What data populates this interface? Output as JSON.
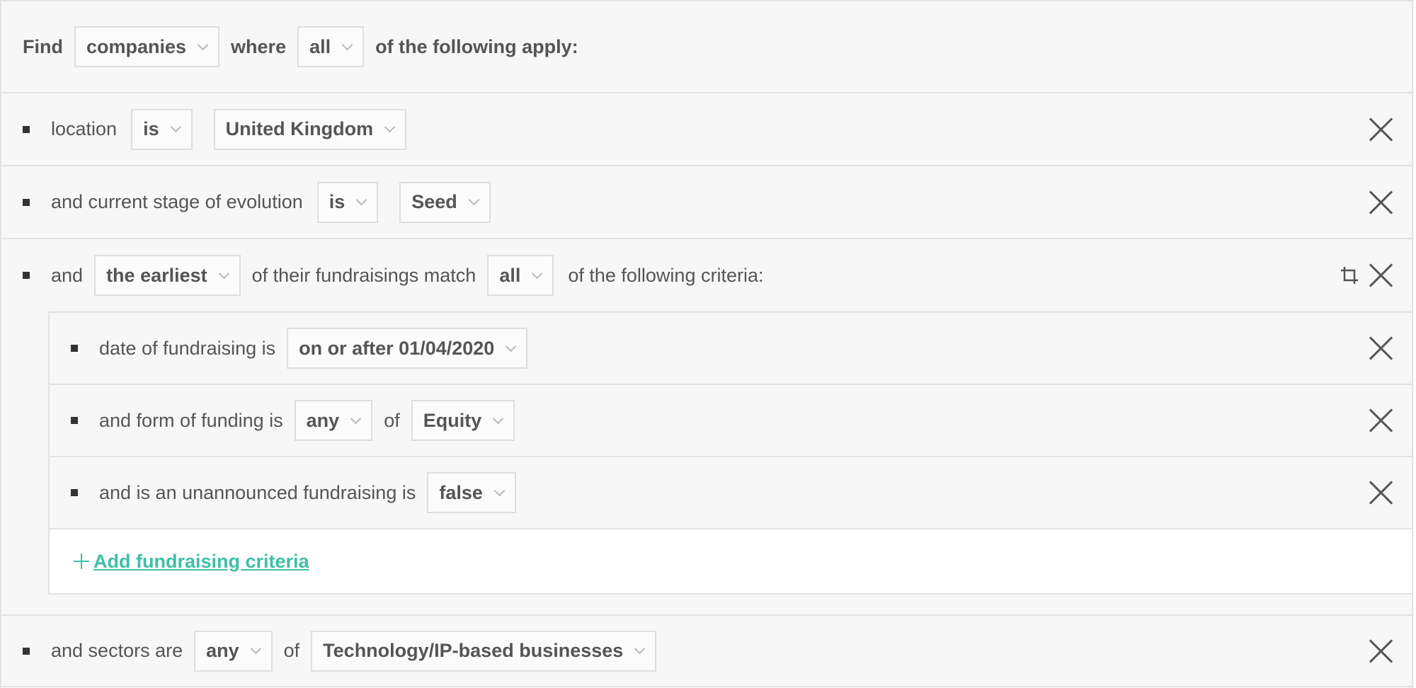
{
  "header": {
    "find_label": "Find",
    "entity_select": "companies",
    "where_label": "where",
    "match_select": "all",
    "suffix": "of the following apply:"
  },
  "criteria": [
    {
      "label": "location",
      "operator": "is",
      "value": "United Kingdom"
    },
    {
      "label": "and current stage of evolution",
      "operator": "is",
      "value": "Seed"
    },
    {
      "prefix": "and",
      "which_select": "the earliest",
      "middle": "of their fundraisings match",
      "match_select": "all",
      "suffix": "of the following criteria:",
      "sub_criteria": [
        {
          "label": "date of fundraising is",
          "value": "on or after 01/04/2020"
        },
        {
          "label": "and form of funding is",
          "quantifier": "any",
          "of_label": "of",
          "value": "Equity"
        },
        {
          "label": "and is an unannounced fundraising is",
          "value": "false"
        }
      ],
      "add_link": "Add fundraising criteria"
    },
    {
      "label": "and sectors are",
      "quantifier": "any",
      "of_label": "of",
      "value": "Technology/IP-based businesses"
    }
  ],
  "colors": {
    "accent": "#3fbfa7",
    "panel_bg": "#f7f7f7",
    "border": "#e2e2e2",
    "text": "#555555"
  }
}
